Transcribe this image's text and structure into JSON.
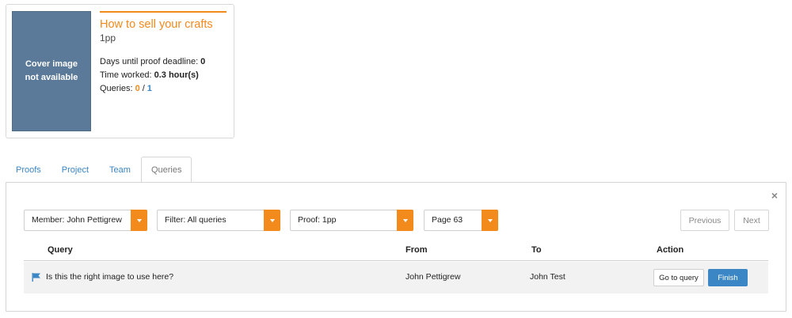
{
  "project": {
    "cover_text": "Cover image not available",
    "title": "How to sell your crafts",
    "subtitle": "1pp",
    "deadline_label": "Days until proof deadline:",
    "deadline_value": "0",
    "time_label": "Time worked:",
    "time_value": "0.3 hour(s)",
    "queries_label": "Queries:",
    "queries_open": "0",
    "queries_sep": "/",
    "queries_total": "1"
  },
  "tabs": [
    {
      "label": "Proofs",
      "active": false
    },
    {
      "label": "Project",
      "active": false
    },
    {
      "label": "Team",
      "active": false
    },
    {
      "label": "Queries",
      "active": true
    }
  ],
  "panel": {
    "close_glyph": "×",
    "filters": {
      "member": "Member: John Pettigrew",
      "filter": "Filter: All queries",
      "proof": "Proof: 1pp",
      "page": "Page 63"
    },
    "previous_label": "Previous",
    "next_label": "Next",
    "table": {
      "columns": [
        "Query",
        "From",
        "To",
        "Action"
      ],
      "rows": [
        {
          "icon": "flag-icon",
          "query": "Is this the right image to use here?",
          "from": "John Pettigrew",
          "to": "John Test",
          "goto_label": "Go to query",
          "finish_label": "Finish"
        }
      ]
    }
  },
  "colors": {
    "accent": "#f28a1c",
    "link": "#3b86c4",
    "cover": "#5b7a99"
  }
}
